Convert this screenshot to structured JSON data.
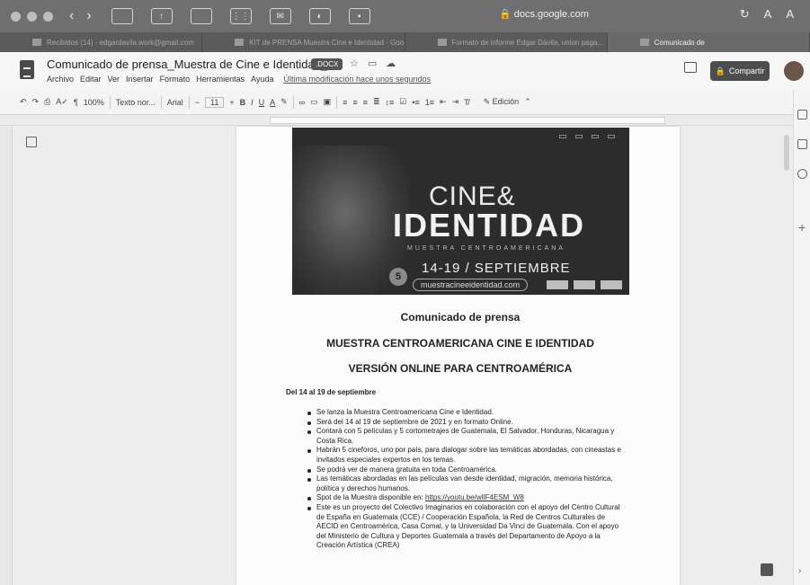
{
  "browser": {
    "address": "docs.google.com",
    "zoom_labels": [
      "A",
      "A"
    ],
    "tabs": [
      {
        "label": "Recibidos (14) - edgardavila.work@gmail.com",
        "active": false
      },
      {
        "label": "KIT de PRENSA Muestra Cine e Identidad - Goo...",
        "active": false
      },
      {
        "label": "Formato de informe Edgar Dávila, union paga...",
        "active": false
      },
      {
        "label": "Comunicado de",
        "active": true
      }
    ]
  },
  "docs": {
    "title": "Comunicado de prensa_Muestra de Cine e Identidad_2",
    "format_badge": ".DOCX",
    "menu": [
      "Archivo",
      "Editar",
      "Ver",
      "Insertar",
      "Formato",
      "Herramientas",
      "Ayuda"
    ],
    "last_edit": "Última modificación hace unos segundos",
    "share_label": "Compartir"
  },
  "toolbar": {
    "zoom": "100%",
    "style": "Texto nor...",
    "font": "Arial",
    "font_size": "11",
    "mode": "Edición"
  },
  "poster": {
    "title_cine": "CINE&",
    "title_identidad": "IDENTIDAD",
    "subtitle": "MUESTRA CENTROAMERICANA",
    "dates": "14-19 / SEPTIEMBRE",
    "url": "muestracineeidentidad.com",
    "edition_number": "5"
  },
  "document": {
    "heading_1": "Comunicado de prensa",
    "heading_2": "MUESTRA CENTROAMERICANA CINE E IDENTIDAD",
    "heading_3": "VERSIÓN ONLINE PARA CENTROAMÉRICA",
    "date_line": "Del 14 al 19 de septiembre",
    "bullets": [
      "Se lanza la Muestra Centroamericana Cine e Identidad.",
      "Será del 14 al 19 de septiembre de 2021 y en formato Online.",
      "Contará con 5 películas y 5 cortometrajes de Guatemala, El Salvador, Honduras, Nicaragua y Costa Rica.",
      "Habrán 5 cineforos, uno por país, para dialogar sobre las temáticas abordadas, con cineastas e invitados especiales expertos en los temas.",
      "Se podrá ver de manera gratuita en toda Centroamérica.",
      "Las temáticas abordadas en las películas van desde identidad, migración, memoria histórica, política y derechos humanos.",
      "Este es un proyecto del Colectivo Imaginarios en colaboración con el apoyo del Centro Cultural de España en Guatemala (CCE) / Cooperación Española, la Red de Centros Culturales de AECID en Centroamérica, Casa Comal, y la Universidad Da Vinci de Guatemala. Con el apoyo del Ministerio de Cultura y Deportes Guatemala a través del Departamento de Apoyo a la Creación Artística (CREA)"
    ],
    "spot_prefix": "Spot de la Muestra disponible en: ",
    "spot_link": "https://youtu.be/wlIF4ESM_W8"
  }
}
